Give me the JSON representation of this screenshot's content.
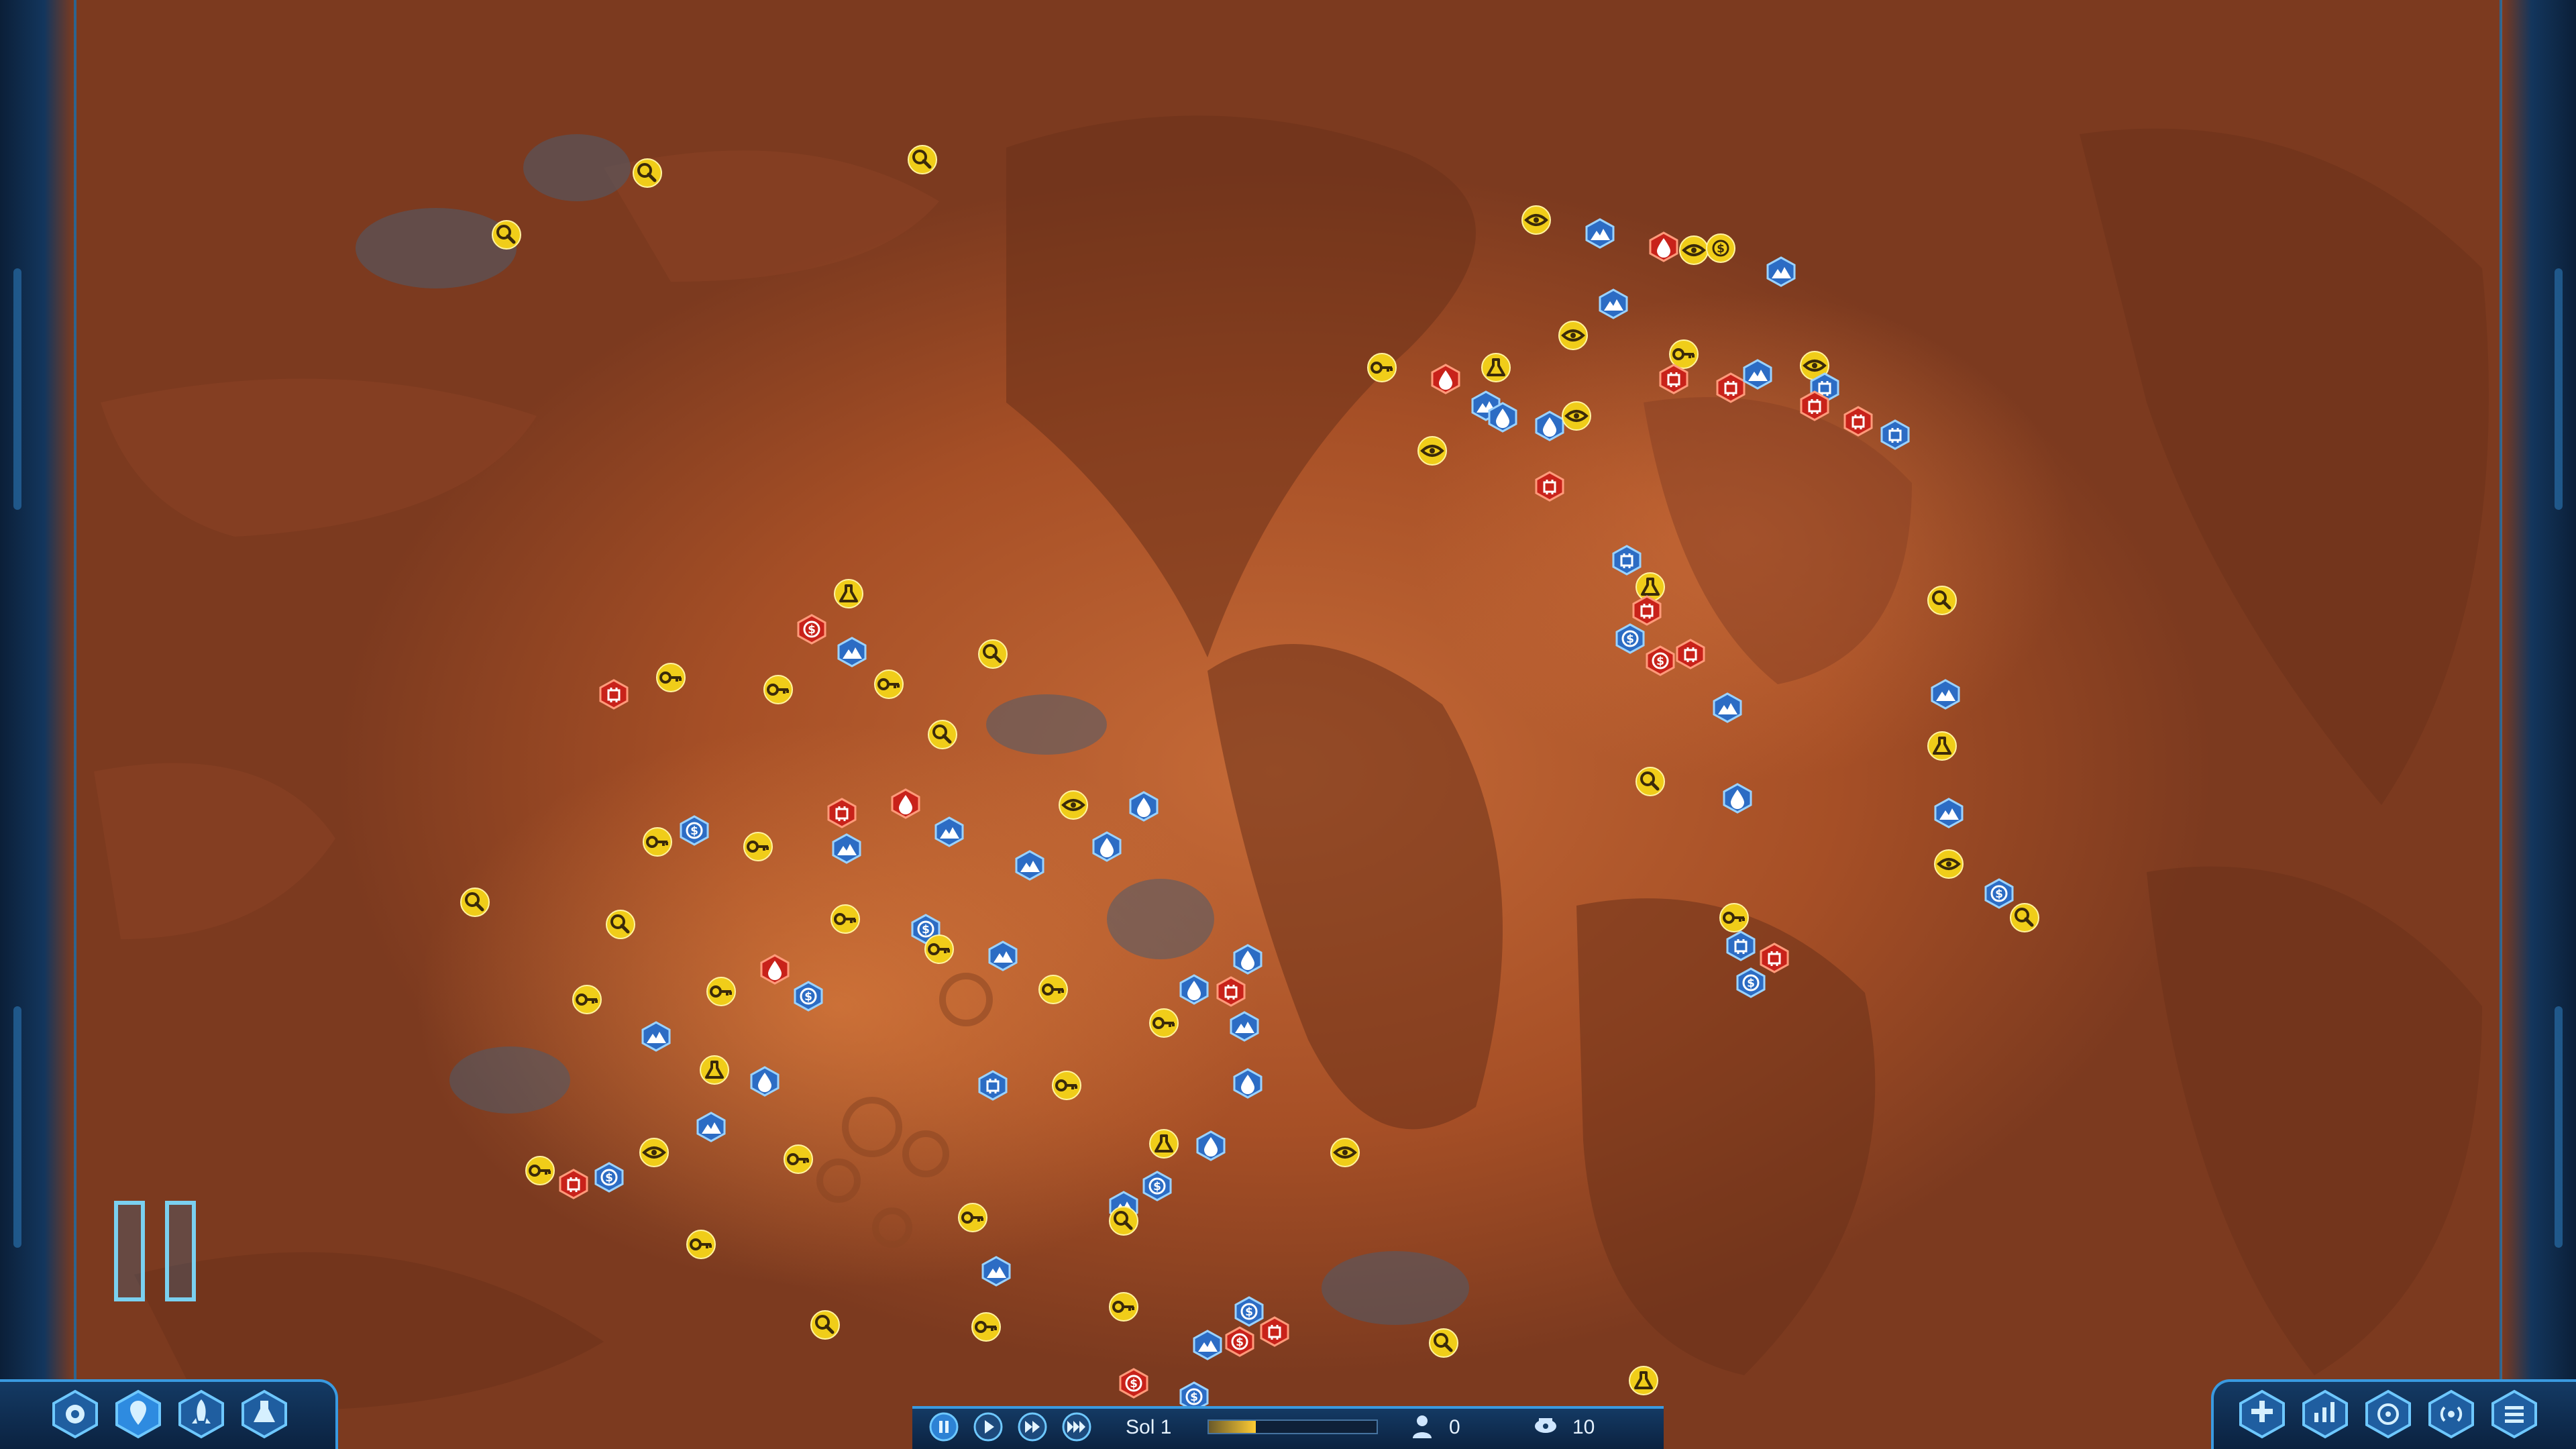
{
  "hud": {
    "sol_label": "Sol 1",
    "sol_progress": 0.28,
    "colonists_count": "0",
    "resource_count": "10",
    "left_buttons": [
      "build-menu",
      "map-markers",
      "rocket",
      "research"
    ],
    "right_buttons": [
      "command-center",
      "stats",
      "targeting",
      "signal",
      "menu"
    ]
  },
  "game": {
    "paused": true
  },
  "colors": {
    "yellow_marker": "#f0cd19",
    "blue_marker": "#2c6cc4",
    "red_marker": "#c8221a",
    "hud_accent": "#3a9ae0"
  },
  "legend_markers": {
    "search-icon": "anomaly scan",
    "key-icon": "breakthrough",
    "eye-icon": "sight",
    "flask-icon": "research",
    "dollar-icon": "funding",
    "water-drop-icon": "water",
    "mountain-icon": "metals",
    "chip-icon": "rare resource"
  }
}
